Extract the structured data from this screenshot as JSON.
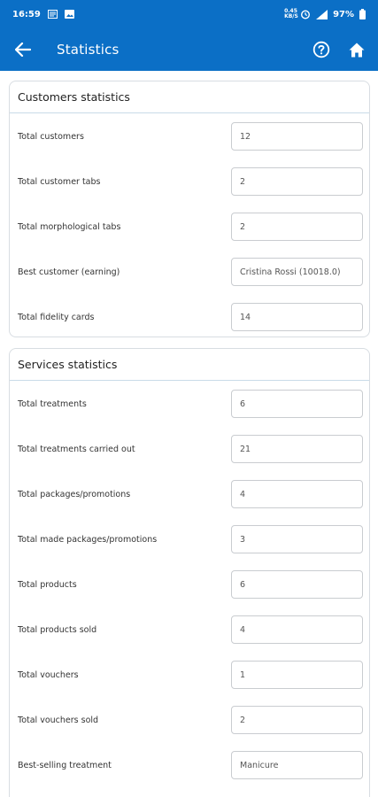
{
  "status_bar": {
    "time": "16:59",
    "network_top": "0.45",
    "network_bottom": "KB/S",
    "battery": "97%"
  },
  "app_bar": {
    "title": "Statistics"
  },
  "customers_section": {
    "title": "Customers statistics",
    "rows": [
      {
        "label": "Total customers",
        "value": "12"
      },
      {
        "label": "Total customer tabs",
        "value": "2"
      },
      {
        "label": "Total morphological tabs",
        "value": "2"
      },
      {
        "label": "Best customer (earning)",
        "value": "Cristina Rossi (10018.0)"
      },
      {
        "label": "Total fidelity cards",
        "value": "14"
      }
    ]
  },
  "services_section": {
    "title": "Services statistics",
    "rows": [
      {
        "label": "Total treatments",
        "value": "6"
      },
      {
        "label": "Total treatments carried out",
        "value": "21"
      },
      {
        "label": "Total packages/promotions",
        "value": "4"
      },
      {
        "label": "Total made packages/promotions",
        "value": "3"
      },
      {
        "label": "Total products",
        "value": "6"
      },
      {
        "label": "Total products sold",
        "value": "4"
      },
      {
        "label": "Total vouchers",
        "value": "1"
      },
      {
        "label": "Total vouchers sold",
        "value": "2"
      },
      {
        "label": "Best-selling treatment",
        "value": "Manicure"
      }
    ]
  },
  "colors": {
    "primary": "#0b6fc6",
    "card_border": "#d8dde2",
    "field_border": "#c9ccd0"
  },
  "icons": [
    "message-icon",
    "image-icon",
    "alarm-icon",
    "signal-icon",
    "battery-icon",
    "back-arrow-icon",
    "help-icon",
    "home-icon"
  ]
}
